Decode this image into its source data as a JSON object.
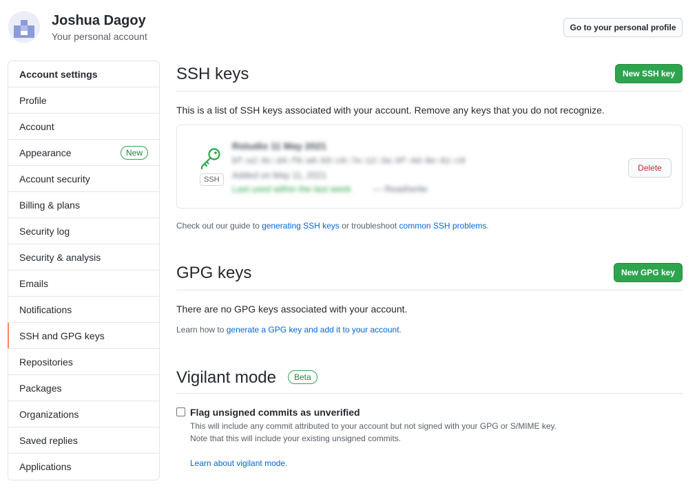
{
  "header": {
    "user_name": "Joshua Dagoy",
    "user_subtitle": "Your personal account",
    "profile_button": "Go to your personal profile"
  },
  "sidebar": {
    "heading": "Account settings",
    "items": [
      {
        "label": "Profile"
      },
      {
        "label": "Account"
      },
      {
        "label": "Appearance",
        "badge": "New"
      },
      {
        "label": "Account security"
      },
      {
        "label": "Billing & plans"
      },
      {
        "label": "Security log"
      },
      {
        "label": "Security & analysis"
      },
      {
        "label": "Emails"
      },
      {
        "label": "Notifications"
      },
      {
        "label": "SSH and GPG keys",
        "selected": true
      },
      {
        "label": "Repositories"
      },
      {
        "label": "Packages"
      },
      {
        "label": "Organizations"
      },
      {
        "label": "Saved replies"
      },
      {
        "label": "Applications"
      }
    ]
  },
  "ssh": {
    "title": "SSH keys",
    "new_button": "New SSH key",
    "description": "This is a list of SSH keys associated with your account. Remove any keys that you do not recognize.",
    "key": {
      "type_label": "SSH",
      "title": "Rstudio 11 May 2021",
      "fingerprint": "bf:e2:9c:d4:f8:a0:b5:c6:7e:12:3a:9f:4d:8e:61:c0",
      "added": "Added on May 11, 2021",
      "last_used": "Last used within the last week",
      "access": "— Read/write",
      "delete_button": "Delete"
    },
    "guide_prefix": "Check out our guide to ",
    "guide_link1": "generating SSH keys",
    "guide_middle": " or troubleshoot ",
    "guide_link2": "common SSH problems",
    "guide_suffix": "."
  },
  "gpg": {
    "title": "GPG keys",
    "new_button": "New GPG key",
    "empty_text": "There are no GPG keys associated with your account.",
    "learn_prefix": "Learn how to ",
    "learn_link": "generate a GPG key and add it to your account",
    "learn_suffix": "."
  },
  "vigilant": {
    "title": "Vigilant mode",
    "badge": "Beta",
    "checkbox_label": "Flag unsigned commits as unverified",
    "checkbox_checked": false,
    "desc_line1": "This will include any commit attributed to your account but not signed with your GPG or S/MIME key.",
    "desc_line2": "Note that this will include your existing unsigned commits.",
    "learn_link": "Learn about vigilant mode."
  },
  "colors": {
    "primary_green": "#2ea44f",
    "link_blue": "#0366d6",
    "danger_red": "#cb2431",
    "selected_accent": "#f9826c"
  }
}
